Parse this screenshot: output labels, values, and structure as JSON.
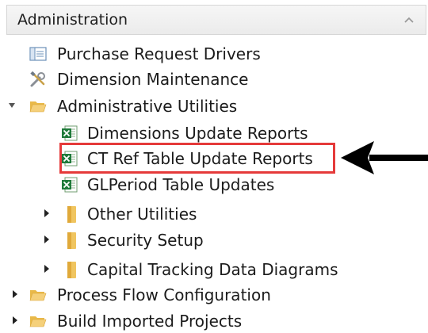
{
  "panel": {
    "title": "Administration",
    "collapse_icon": "chevron-up-icon"
  },
  "tree": {
    "purchase_request_drivers": {
      "label": "Purchase Request Drivers",
      "icon": "form-list-icon"
    },
    "dimension_maintenance": {
      "label": "Dimension Maintenance",
      "icon": "tools-icon"
    },
    "administrative_utilities": {
      "label": "Administrative Utilities",
      "icon": "folder-open-icon",
      "expanded": true,
      "children": {
        "dimensions_update_reports": {
          "label": "Dimensions Update Reports",
          "icon": "excel-icon"
        },
        "ct_ref_table_update_reports": {
          "label": "CT Ref Table Update Reports",
          "icon": "excel-icon"
        },
        "glperiod_table_updates": {
          "label": "GLPeriod Table Updates",
          "icon": "excel-icon"
        },
        "other_utilities": {
          "label": "Other Utilities",
          "icon": "folder-icon"
        },
        "security_setup": {
          "label": "Security Setup",
          "icon": "folder-icon"
        },
        "capital_tracking_data_diagrams": {
          "label": "Capital Tracking Data Diagrams",
          "icon": "folder-icon"
        }
      }
    },
    "process_flow_configuration": {
      "label": "Process Flow Configuration",
      "icon": "folder-open-icon"
    },
    "build_imported_projects": {
      "label": "Build Imported Projects",
      "icon": "folder-open-icon"
    }
  },
  "annotation": {
    "highlight_color": "#e53a3a",
    "arrow_color": "#000000",
    "highlighted_item": "CT Ref Table Update Reports"
  }
}
